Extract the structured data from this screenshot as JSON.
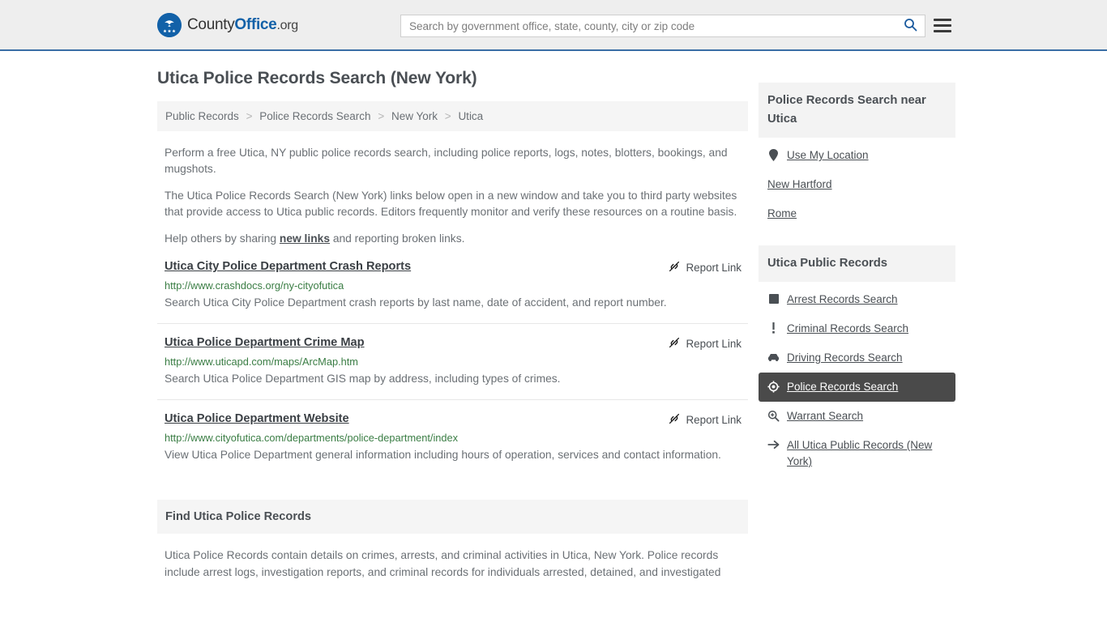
{
  "header": {
    "brand": {
      "part1": "County",
      "part2": "Office",
      "part3": ".org",
      "logo_icon": "eagle-seal-icon"
    },
    "search": {
      "placeholder": "Search by government office, state, county, city or zip code",
      "value": "",
      "search_icon": "search-icon"
    },
    "menu_icon": "hamburger-menu-icon",
    "accent_color": "#3a6ea5",
    "background_color": "#eeeeee"
  },
  "main": {
    "title": "Utica Police Records Search (New York)",
    "breadcrumb": [
      {
        "label": "Public Records"
      },
      {
        "label": "Police Records Search"
      },
      {
        "label": "New York"
      },
      {
        "label": "Utica"
      }
    ],
    "breadcrumb_separator": ">",
    "intro": [
      "Perform a free Utica, NY public police records search, including police reports, logs, notes, blotters, bookings, and mugshots.",
      "The Utica Police Records Search (New York) links below open in a new window and take you to third party websites that provide access to Utica public records. Editors frequently monitor and verify these resources on a routine basis."
    ],
    "share_prefix": "Help others by sharing ",
    "share_link": "new links",
    "share_suffix": " and reporting broken links.",
    "report_link_label": "Report Link",
    "report_link_icon": "broken-link-icon",
    "results": [
      {
        "title": "Utica City Police Department Crash Reports",
        "url": "http://www.crashdocs.org/ny-cityofutica",
        "description": "Search Utica City Police Department crash reports by last name, date of accident, and report number."
      },
      {
        "title": "Utica Police Department Crime Map",
        "url": "http://www.uticapd.com/maps/ArcMap.htm",
        "description": "Search Utica Police Department GIS map by address, including types of crimes."
      },
      {
        "title": "Utica Police Department Website",
        "url": "http://www.cityofutica.com/departments/police-department/index",
        "description": "View Utica Police Department general information including hours of operation, services and contact information."
      }
    ],
    "find_section": {
      "heading": "Find Utica Police Records",
      "body": "Utica Police Records contain details on crimes, arrests, and criminal activities in Utica, New York. Police records include arrest logs, investigation reports, and criminal records for individuals arrested, detained, and investigated"
    }
  },
  "sidebar": {
    "near_card": {
      "heading": "Police Records Search near Utica",
      "items": [
        {
          "label": "Use My Location",
          "icon": "map-pin-icon",
          "has_icon": true
        },
        {
          "label": "New Hartford",
          "icon": "",
          "has_icon": false
        },
        {
          "label": "Rome",
          "icon": "",
          "has_icon": false
        }
      ]
    },
    "public_records_card": {
      "heading": "Utica Public Records",
      "items": [
        {
          "label": "Arrest Records Search",
          "icon": "fingerprint-square-icon",
          "active": false
        },
        {
          "label": "Criminal Records Search",
          "icon": "exclamation-icon",
          "active": false
        },
        {
          "label": "Driving Records Search",
          "icon": "car-icon",
          "active": false
        },
        {
          "label": "Police Records Search",
          "icon": "police-badge-icon",
          "active": true
        },
        {
          "label": "Warrant Search",
          "icon": "magnifier-plus-icon",
          "active": false
        },
        {
          "label": "All Utica Public Records (New York)",
          "icon": "arrow-right-icon",
          "active": false
        }
      ],
      "active_background": "#4a4a4a"
    }
  }
}
